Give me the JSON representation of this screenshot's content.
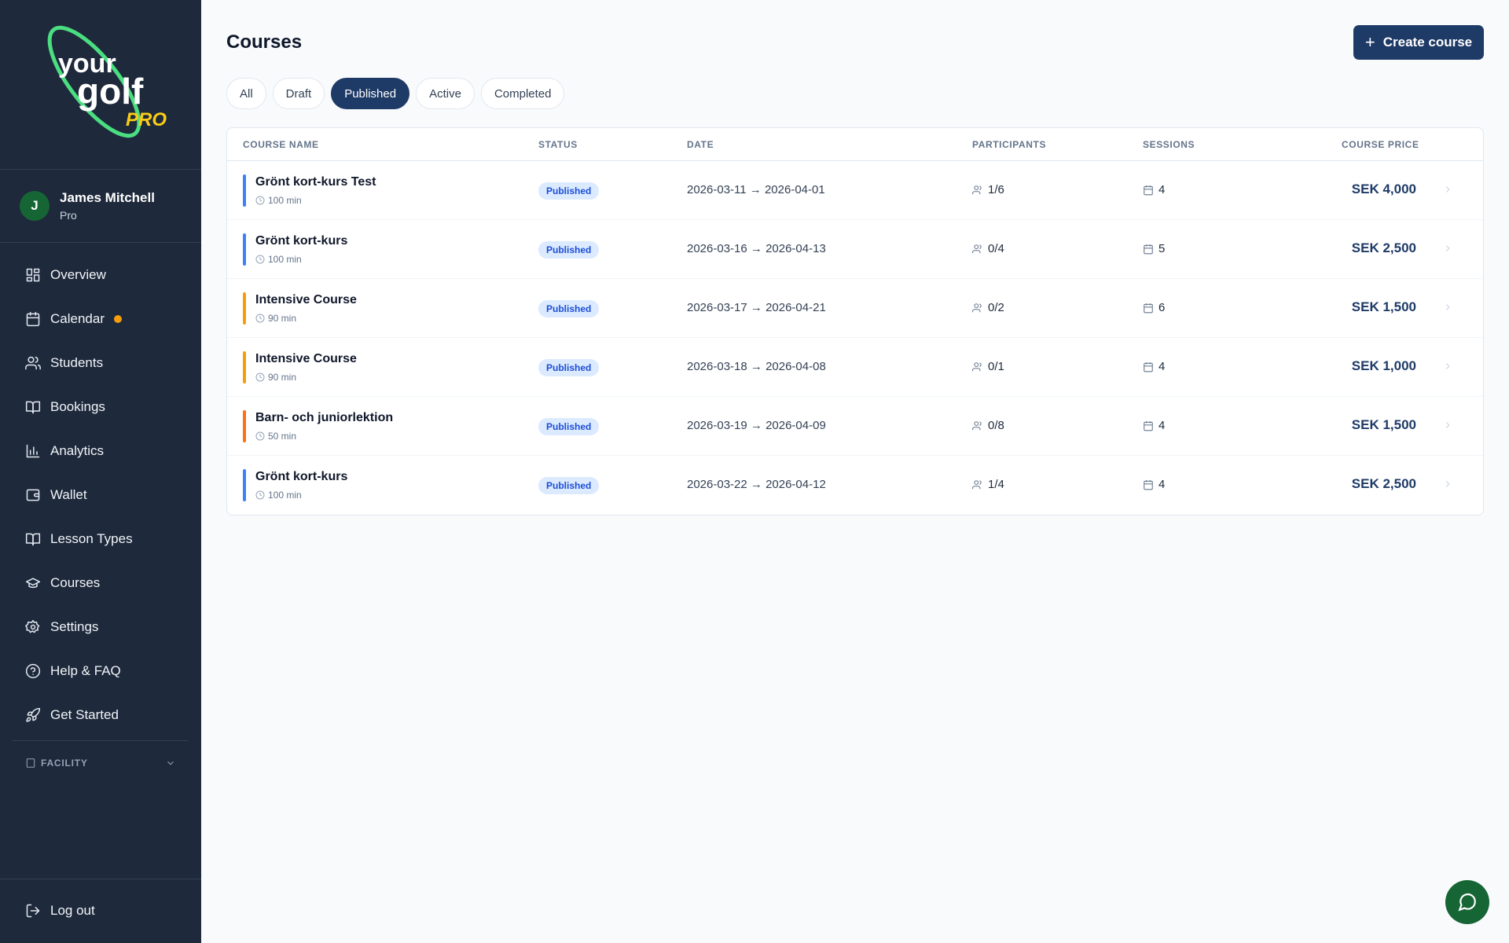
{
  "brand": {
    "logo_text_1": "your",
    "logo_text_2": "golf",
    "logo_text_3": "PRO"
  },
  "user": {
    "initial": "J",
    "name": "James Mitchell",
    "role": "Pro"
  },
  "nav": [
    {
      "label": "Overview",
      "icon": "grid-icon"
    },
    {
      "label": "Calendar",
      "icon": "calendar-icon",
      "dot": true
    },
    {
      "label": "Students",
      "icon": "users-icon"
    },
    {
      "label": "Bookings",
      "icon": "book-icon"
    },
    {
      "label": "Analytics",
      "icon": "bar-chart-icon"
    },
    {
      "label": "Wallet",
      "icon": "wallet-icon"
    },
    {
      "label": "Lesson Types",
      "icon": "book-open-icon"
    },
    {
      "label": "Courses",
      "icon": "graduation-cap-icon"
    },
    {
      "label": "Settings",
      "icon": "gear-icon"
    },
    {
      "label": "Help & FAQ",
      "icon": "help-circle-icon"
    },
    {
      "label": "Get Started",
      "icon": "rocket-icon"
    }
  ],
  "facility": {
    "label": "FACILITY"
  },
  "logout": {
    "label": "Log out"
  },
  "page": {
    "title": "Courses",
    "create_label": "Create course"
  },
  "filters": [
    {
      "label": "All",
      "active": false
    },
    {
      "label": "Draft",
      "active": false
    },
    {
      "label": "Published",
      "active": true
    },
    {
      "label": "Active",
      "active": false
    },
    {
      "label": "Completed",
      "active": false
    }
  ],
  "table": {
    "headers": {
      "name": "COURSE NAME",
      "status": "STATUS",
      "date": "DATE",
      "participants": "PARTICIPANTS",
      "sessions": "SESSIONS",
      "price": "COURSE PRICE"
    },
    "rows": [
      {
        "name": "Grönt kort-kurs Test",
        "duration": "100 min",
        "status": "Published",
        "date": "2026-03-11 → 2026-04-01",
        "participants": "1/6",
        "sessions": "4",
        "price": "SEK 4,000",
        "color": "#3b82f6"
      },
      {
        "name": "Grönt kort-kurs",
        "duration": "100 min",
        "status": "Published",
        "date": "2026-03-16 → 2026-04-13",
        "participants": "0/4",
        "sessions": "5",
        "price": "SEK 2,500",
        "color": "#3b82f6"
      },
      {
        "name": "Intensive Course",
        "duration": "90 min",
        "status": "Published",
        "date": "2026-03-17 → 2026-04-21",
        "participants": "0/2",
        "sessions": "6",
        "price": "SEK 1,500",
        "color": "#f59e0b"
      },
      {
        "name": "Intensive Course",
        "duration": "90 min",
        "status": "Published",
        "date": "2026-03-18 → 2026-04-08",
        "participants": "0/1",
        "sessions": "4",
        "price": "SEK 1,000",
        "color": "#f59e0b"
      },
      {
        "name": "Barn- och juniorlektion",
        "duration": "50 min",
        "status": "Published",
        "date": "2026-03-19 → 2026-04-09",
        "participants": "0/8",
        "sessions": "4",
        "price": "SEK 1,500",
        "color": "#f97316"
      },
      {
        "name": "Grönt kort-kurs",
        "duration": "100 min",
        "status": "Published",
        "date": "2026-03-22 → 2026-04-12",
        "participants": "1/4",
        "sessions": "4",
        "price": "SEK 2,500",
        "color": "#3b82f6"
      }
    ]
  }
}
